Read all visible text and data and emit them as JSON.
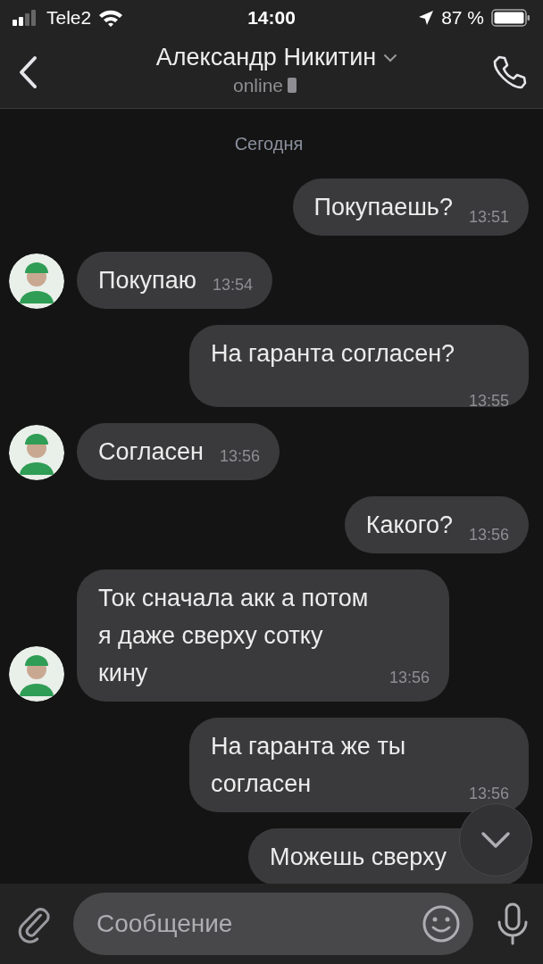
{
  "status_bar": {
    "carrier": "Tele2",
    "time": "14:00",
    "battery": "87 %"
  },
  "header": {
    "title": "Александр Никитин",
    "status": "online"
  },
  "date_separator": "Сегодня",
  "messages": [
    {
      "kind": "outgoing",
      "text": "Покупаешь?",
      "time": "13:51"
    },
    {
      "kind": "incoming",
      "text": "Покупаю",
      "time": "13:54"
    },
    {
      "kind": "outgoing",
      "text": "На гаранта согласен?",
      "time": "13:55"
    },
    {
      "kind": "incoming",
      "text": "Согласен",
      "time": "13:56"
    },
    {
      "kind": "outgoing",
      "text": "Какого?",
      "time": "13:56"
    },
    {
      "kind": "incoming",
      "text": "Ток сначала акк а потом я даже сверху сотку кину",
      "time": "13:56"
    },
    {
      "kind": "outgoing",
      "text": "На гаранта же ты согласен",
      "time": "13:56"
    },
    {
      "kind": "outgoing",
      "text": "Можешь сверху"
    }
  ],
  "composer": {
    "placeholder": "Сообщение"
  }
}
